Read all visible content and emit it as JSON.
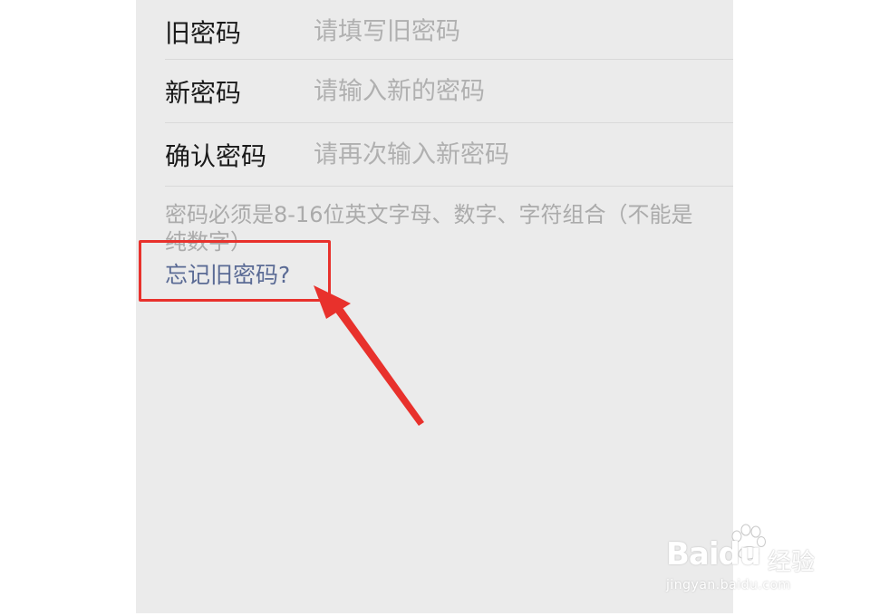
{
  "form": {
    "old_password": {
      "label": "旧密码",
      "placeholder": "请填写旧密码"
    },
    "new_password": {
      "label": "新密码",
      "placeholder": "请输入新的密码"
    },
    "confirm_password": {
      "label": "确认密码",
      "placeholder": "请再次输入新密码"
    },
    "hint": "密码必须是8-16位英文字母、数字、字符组合（不能是纯数字）",
    "forgot_link": "忘记旧密码?"
  },
  "annotation": {
    "color": "#e8312c"
  },
  "watermark": {
    "brand": "Baidu",
    "brand_suffix": "经验",
    "url": "jingyan.baidu.com"
  },
  "colors": {
    "background": "#ebebeb",
    "link": "#5b6b95",
    "placeholder": "#b0b0b0",
    "hint": "#ababab"
  }
}
